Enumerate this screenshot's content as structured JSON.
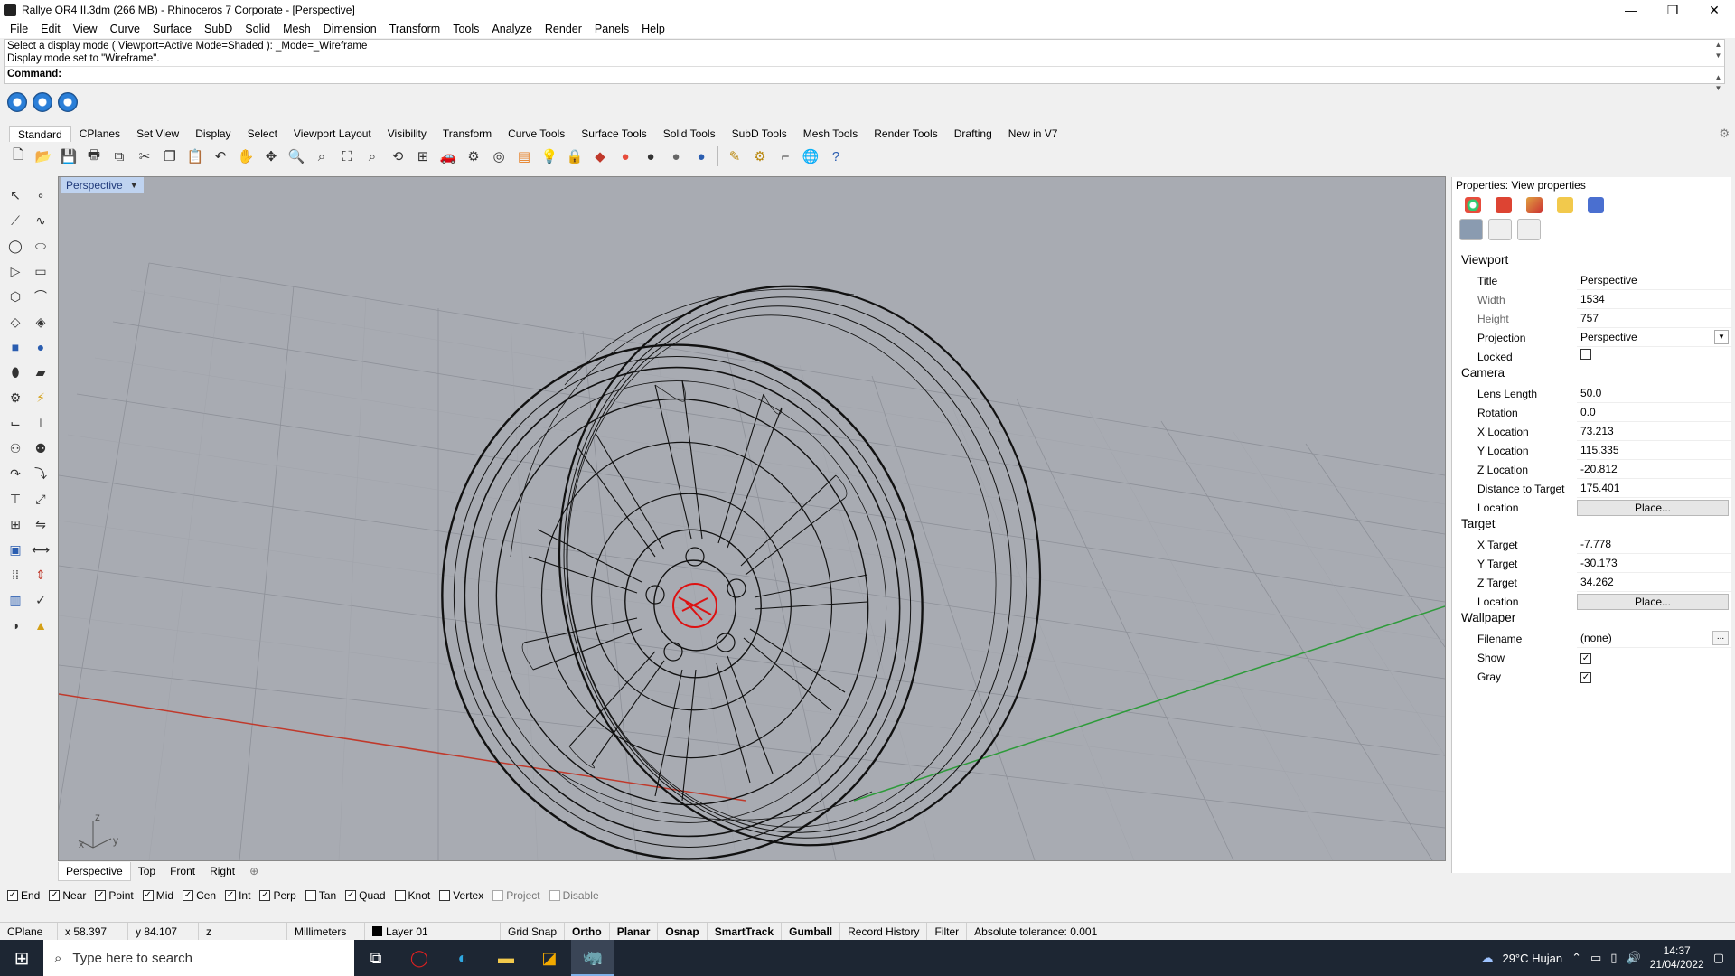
{
  "window": {
    "title": "Rallye OR4 II.3dm (266 MB) - Rhinoceros 7 Corporate - [Perspective]",
    "minimize": "—",
    "maximize": "❐",
    "close": "✕"
  },
  "menu": [
    "File",
    "Edit",
    "View",
    "Curve",
    "Surface",
    "SubD",
    "Solid",
    "Mesh",
    "Dimension",
    "Transform",
    "Tools",
    "Analyze",
    "Render",
    "Panels",
    "Help"
  ],
  "command": {
    "history": [
      "Select a display mode ( Viewport=Active  Mode=Shaded ): _Mode=_Wireframe",
      "Display mode set to \"Wireframe\"."
    ],
    "prompt": "Command:"
  },
  "tabs": [
    "Standard",
    "CPlanes",
    "Set View",
    "Display",
    "Select",
    "Viewport Layout",
    "Visibility",
    "Transform",
    "Curve Tools",
    "Surface Tools",
    "Solid Tools",
    "SubD Tools",
    "Mesh Tools",
    "Render Tools",
    "Drafting",
    "New in V7"
  ],
  "toolbar_icons": [
    "new-file-icon",
    "open-icon",
    "save-icon",
    "print-icon",
    "import-icon",
    "cut-icon",
    "copy-icon",
    "paste-icon",
    "undo-icon",
    "pan-icon",
    "move-icon",
    "zoom-icon",
    "zoom-window-icon",
    "zoom-extents-icon",
    "zoom-selected-icon",
    "rotate-view-icon",
    "four-viewports-icon",
    "car-icon",
    "properties-icon",
    "point-icon",
    "layer-icon",
    "light-icon",
    "lock-icon",
    "material-icon",
    "color-icon",
    "shaded-sphere-icon",
    "rendered-sphere-icon",
    "render-sphere-icon",
    "analysis-icon",
    "gear-tool-icon",
    "dimension-icon",
    "globe-icon",
    "help-icon"
  ],
  "viewport": {
    "label": "Perspective",
    "axis_x": "x",
    "axis_y": "y",
    "axis_z": "z"
  },
  "viewport_tabs": [
    "Perspective",
    "Top",
    "Front",
    "Right"
  ],
  "osnaps": [
    {
      "label": "End",
      "checked": true
    },
    {
      "label": "Near",
      "checked": true
    },
    {
      "label": "Point",
      "checked": true
    },
    {
      "label": "Mid",
      "checked": true
    },
    {
      "label": "Cen",
      "checked": true
    },
    {
      "label": "Int",
      "checked": true
    },
    {
      "label": "Perp",
      "checked": true
    },
    {
      "label": "Tan",
      "checked": false
    },
    {
      "label": "Quad",
      "checked": true
    },
    {
      "label": "Knot",
      "checked": false
    },
    {
      "label": "Vertex",
      "checked": false
    },
    {
      "label": "Project",
      "checked": false,
      "disabled": true
    },
    {
      "label": "Disable",
      "checked": false,
      "disabled": true
    }
  ],
  "status": {
    "cplane": "CPlane",
    "x": "x 58.397",
    "y": "y 84.107",
    "z": "z",
    "units": "Millimeters",
    "layer": "Layer 01",
    "grid_snap": "Grid Snap",
    "ortho": "Ortho",
    "planar": "Planar",
    "osnap": "Osnap",
    "smarttrack": "SmartTrack",
    "gumball": "Gumball",
    "record_history": "Record History",
    "filter": "Filter",
    "tolerance": "Absolute tolerance: 0.001"
  },
  "taskbar": {
    "search_placeholder": "Type here to search",
    "weather": "29°C  Hujan",
    "time": "14:37",
    "date": "21/04/2022"
  },
  "properties": {
    "title": "Properties: View properties",
    "sections": {
      "viewport": "Viewport",
      "camera": "Camera",
      "target": "Target",
      "wallpaper": "Wallpaper"
    },
    "viewport": {
      "title_label": "Title",
      "title": "Perspective",
      "width_label": "Width",
      "width": "1534",
      "height_label": "Height",
      "height": "757",
      "projection_label": "Projection",
      "projection": "Perspective",
      "locked_label": "Locked",
      "locked": false
    },
    "camera": {
      "lens_label": "Lens Length",
      "lens": "50.0",
      "rotation_label": "Rotation",
      "rotation": "0.0",
      "x_label": "X Location",
      "x": "73.213",
      "y_label": "Y Location",
      "y": "115.335",
      "z_label": "Z Location",
      "z": "-20.812",
      "dist_label": "Distance to Target",
      "dist": "175.401",
      "location_label": "Location",
      "place": "Place..."
    },
    "target": {
      "x_label": "X Target",
      "x": "-7.778",
      "y_label": "Y Target",
      "y": "-30.173",
      "z_label": "Z Target",
      "z": "34.262",
      "location_label": "Location",
      "place": "Place..."
    },
    "wallpaper": {
      "filename_label": "Filename",
      "filename": "(none)",
      "show_label": "Show",
      "show": true,
      "gray_label": "Gray",
      "gray": true,
      "browse": "..."
    }
  },
  "colors": {
    "viewport_bg": "#a8abb2",
    "x_axis": "#c0392b",
    "y_axis": "#2e9b3a",
    "active_label": "#bfd3f0"
  }
}
